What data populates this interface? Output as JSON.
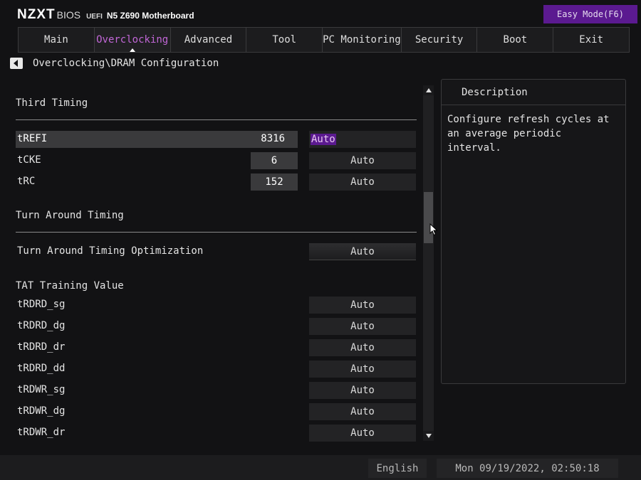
{
  "brand": {
    "logo": "NZXT",
    "bios": "BIOS",
    "uefi": "UEFI",
    "model": "N5 Z690 Motherboard"
  },
  "easy_mode_label": "Easy Mode(F6)",
  "tabs": [
    {
      "label": "Main"
    },
    {
      "label": "Overclocking",
      "active": true
    },
    {
      "label": "Advanced"
    },
    {
      "label": "Tool"
    },
    {
      "label": "PC Monitoring"
    },
    {
      "label": "Security"
    },
    {
      "label": "Boot"
    },
    {
      "label": "Exit"
    }
  ],
  "breadcrumb": "Overclocking\\DRAM Configuration",
  "sections": {
    "third_timing": "Third Timing",
    "turn_around": "Turn Around Timing",
    "tat_training": "TAT Training Value"
  },
  "third_timing_rows": [
    {
      "label": "tREFI",
      "value": "8316",
      "mode": "Auto"
    },
    {
      "label": "tCKE",
      "value": "6",
      "mode": "Auto"
    },
    {
      "label": "tRC",
      "value": "152",
      "mode": "Auto"
    }
  ],
  "turn_around_row": {
    "label": "Turn Around Timing Optimization",
    "mode": "Auto"
  },
  "tat_rows": [
    {
      "label": "tRDRD_sg",
      "mode": "Auto"
    },
    {
      "label": "tRDRD_dg",
      "mode": "Auto"
    },
    {
      "label": "tRDRD_dr",
      "mode": "Auto"
    },
    {
      "label": "tRDRD_dd",
      "mode": "Auto"
    },
    {
      "label": "tRDWR_sg",
      "mode": "Auto"
    },
    {
      "label": "tRDWR_dg",
      "mode": "Auto"
    },
    {
      "label": "tRDWR_dr",
      "mode": "Auto"
    }
  ],
  "description": {
    "title": "Description",
    "text": "Configure refresh cycles at an average periodic interval."
  },
  "footer": {
    "language": "English",
    "datetime": "Mon 09/19/2022, 02:50:18"
  },
  "colors": {
    "accent": "#c267d8",
    "easy_mode_bg": "#5b1a90",
    "background": "#121214"
  },
  "icons": {
    "back": "triangle-left-icon",
    "scroll_up": "triangle-up-icon",
    "scroll_down": "triangle-down-icon",
    "cursor": "mouse-pointer-icon"
  }
}
